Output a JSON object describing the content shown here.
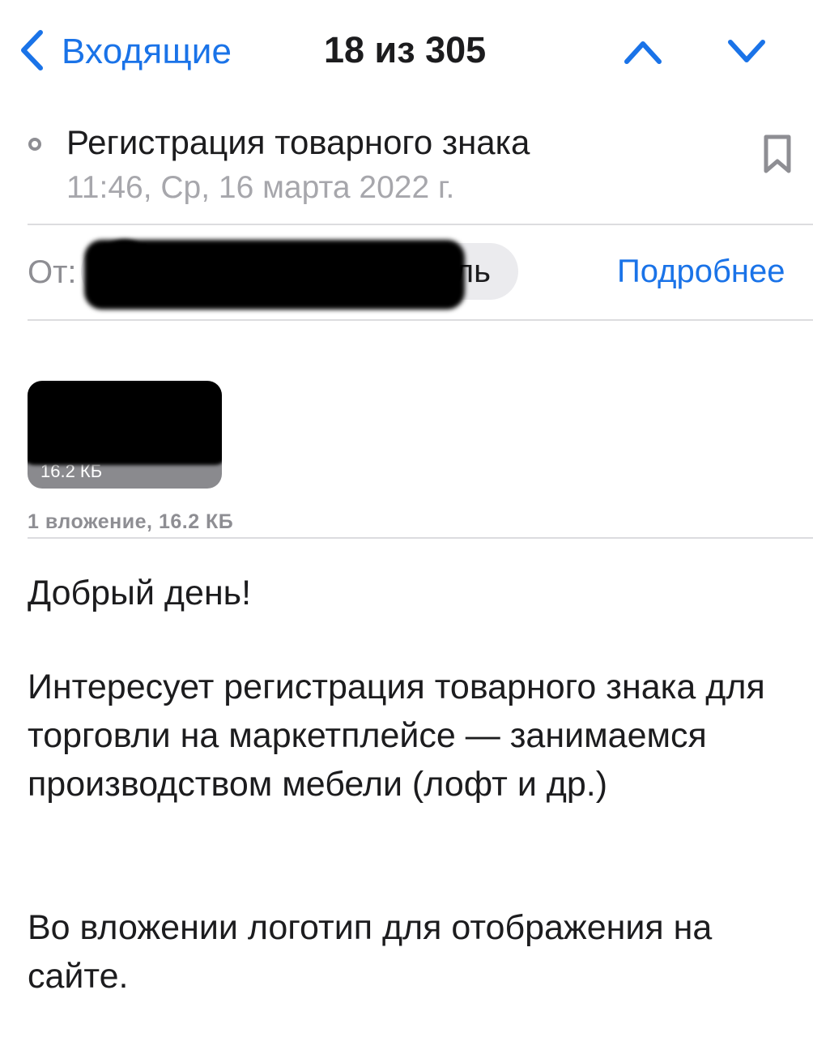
{
  "nav": {
    "back_label": "Входящие",
    "counter": "18 из 305"
  },
  "message": {
    "subject": "Регистрация товарного знака",
    "date": "11:46, Ср, 16 марта 2022 г.",
    "from_label": "От:",
    "sender_visible_fragment": "ель",
    "details_link": "Подробнее"
  },
  "attachment": {
    "size_badge": "16.2 КБ",
    "summary": "1 вложение, 16.2 КБ"
  },
  "body": {
    "greeting": "Добрый день!",
    "paragraph_1": "Интересует регистрация товарного знака для торговли на маркетплейсе — занимаемся производством мебели (лофт и др.)",
    "paragraph_2": "Во вложении логотип для отображения на сайте."
  },
  "colors": {
    "accent": "#1a73e8",
    "secondary_text": "#8e8e93",
    "date_text": "#a7a7ac"
  },
  "icons": {
    "back": "chevron-left-icon",
    "previous": "chevron-up-icon",
    "next": "chevron-down-icon",
    "unread": "unread-dot-icon",
    "flag": "bookmark-icon"
  }
}
